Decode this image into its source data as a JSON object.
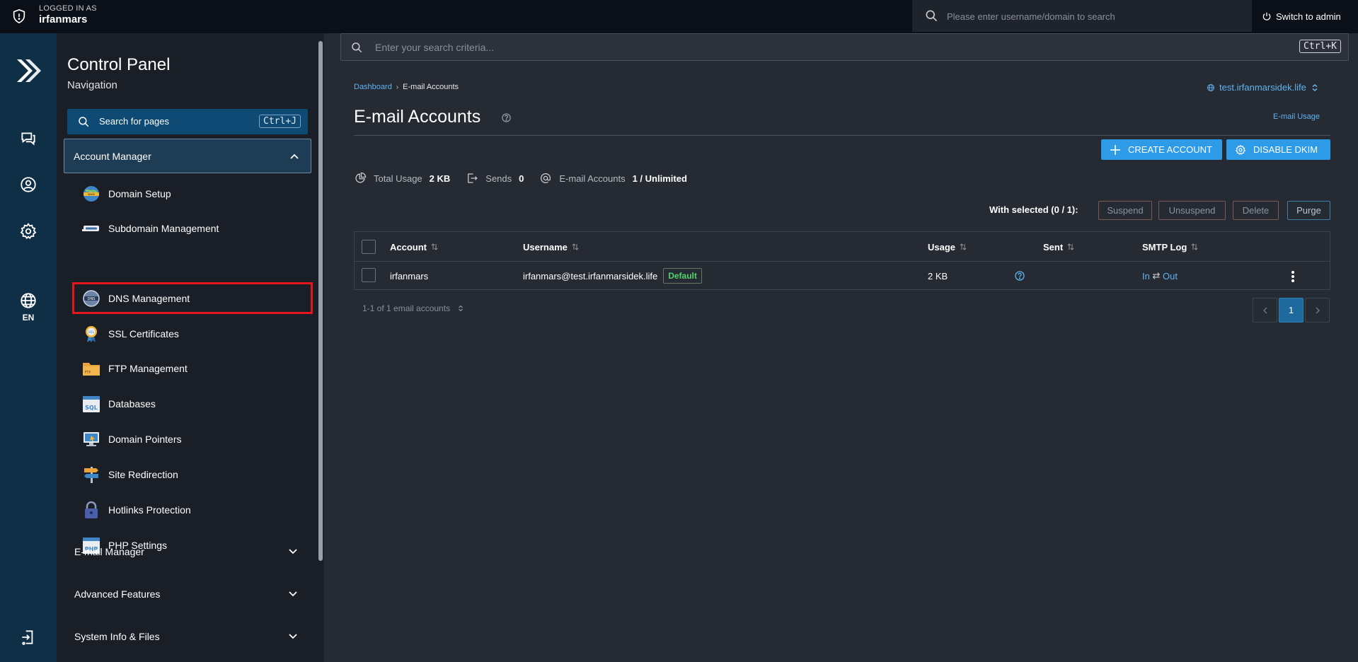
{
  "topbar": {
    "logged_label": "LOGGED IN AS",
    "username": "irfanmars",
    "search_placeholder": "Please enter username/domain to search",
    "switch_admin": "Switch to admin"
  },
  "rail": {
    "lang": "EN"
  },
  "nav": {
    "title": "Control Panel",
    "subtitle": "Navigation",
    "search_label": "Search for pages",
    "search_shortcut": "Ctrl+J",
    "account_manager": "Account Manager",
    "items": [
      {
        "label": "Domain Setup",
        "icon": "domain-setup-icon"
      },
      {
        "label": "Subdomain Management",
        "icon": "subdomain-icon"
      },
      {
        "label": "DNS Management",
        "icon": "dns-icon"
      },
      {
        "label": "SSL Certificates",
        "icon": "ssl-certificate-icon"
      },
      {
        "label": "FTP Management",
        "icon": "ftp-folder-icon"
      },
      {
        "label": "Databases",
        "icon": "database-sql-icon"
      },
      {
        "label": "Domain Pointers",
        "icon": "domain-pointer-icon"
      },
      {
        "label": "Site Redirection",
        "icon": "signpost-icon"
      },
      {
        "label": "Hotlinks Protection",
        "icon": "padlock-icon"
      },
      {
        "label": "PHP Settings",
        "icon": "php-icon"
      }
    ],
    "sections": [
      {
        "label": "E-mail Manager"
      },
      {
        "label": "Advanced Features"
      },
      {
        "label": "System Info & Files"
      }
    ]
  },
  "main": {
    "search_placeholder": "Enter your search criteria...",
    "search_shortcut": "Ctrl+K",
    "breadcrumb": {
      "home": "Dashboard",
      "current": "E-mail Accounts"
    },
    "domain": "test.irfanmarsidek.life",
    "title": "E-mail Accounts",
    "email_usage_link": "E-mail Usage",
    "create_account": "CREATE ACCOUNT",
    "disable_dkim": "DISABLE DKIM",
    "stats": {
      "total_usage_label": "Total Usage",
      "total_usage": "2 KB",
      "sends_label": "Sends",
      "sends": "0",
      "accounts_label": "E-mail Accounts",
      "accounts": "1 / Unlimited"
    },
    "with_selected": "With selected (0 / 1):",
    "bulk_actions": {
      "suspend": "Suspend",
      "unsuspend": "Unsuspend",
      "delete": "Delete",
      "purge": "Purge"
    },
    "table": {
      "columns": {
        "account": "Account",
        "username": "Username",
        "usage": "Usage",
        "sent": "Sent",
        "smtp_log": "SMTP Log"
      },
      "rows": [
        {
          "account": "irfanmars",
          "username": "irfanmars@test.irfanmarsidek.life",
          "badge": "Default",
          "usage": "2 KB",
          "smtp_in": "In",
          "smtp_arrow": "⇄",
          "smtp_out": "Out"
        }
      ]
    },
    "pager": {
      "info": "1-1 of 1 email accounts",
      "page": "1"
    }
  },
  "colors": {
    "accent": "#2d9be8",
    "highlight": "#e3161c",
    "rail": "#0f2f47"
  }
}
